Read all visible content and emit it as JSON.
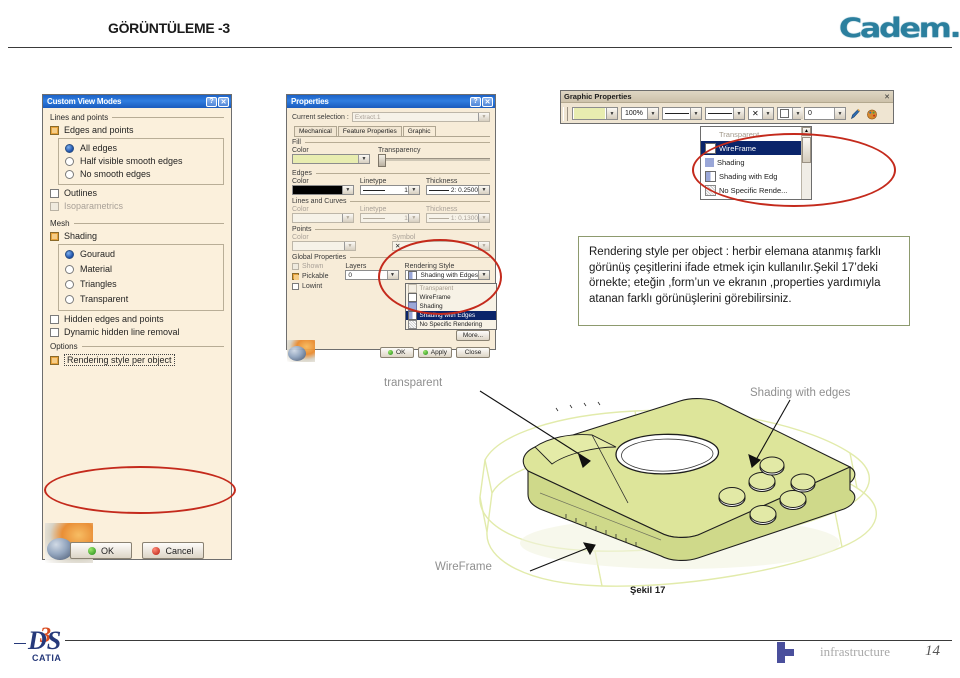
{
  "header": {
    "title": "GÖRÜNTÜLEME -3",
    "brand": "Cadem."
  },
  "footer": {
    "ds_mark": "DS",
    "ds_swoosh": "3",
    "ds_name": "CATIA",
    "infrastructure": "infrastructure",
    "page_number": "14"
  },
  "custom_view_dialog": {
    "title": "Custom View Modes",
    "help_btn": "?",
    "close_btn": "✕",
    "groups": {
      "lines_and_points": "Lines and points",
      "mesh": "Mesh",
      "options": "Options"
    },
    "edges_and_points": "Edges and points",
    "edge_options": [
      "All edges",
      "Half visible smooth edges",
      "No smooth edges"
    ],
    "edge_selected": "All edges",
    "outlines": "Outlines",
    "isoparametrics": "Isoparametrics",
    "shading": "Shading",
    "shading_options": [
      "Gouraud",
      "Material",
      "Triangles",
      "Transparent"
    ],
    "shading_selected": "Gouraud",
    "hidden_edges_and_points": "Hidden edges and points",
    "dynamic_hidden_line_removal": "Dynamic hidden line removal",
    "rendering_style_per_object": "Rendering style per object",
    "ok_label": "OK",
    "cancel_label": "Cancel"
  },
  "properties_dialog": {
    "title": "Properties",
    "help_btn": "?",
    "close_btn": "✕",
    "current_selection_label": "Current selection :",
    "current_selection_value": "Extract.1",
    "tabs": [
      "Mechanical",
      "Feature Properties",
      "Graphic"
    ],
    "active_tab": "Graphic",
    "fill": {
      "group": "Fill",
      "color_label": "Color",
      "color_value": "#e8edb0",
      "transparency_label": "Transparency",
      "transparency_value": "0"
    },
    "edges": {
      "group": "Edges",
      "color_label": "Color",
      "color_value": "#000000",
      "linetype_label": "Linetype",
      "linetype_value": "1",
      "thickness_label": "Thickness",
      "thickness_value": "2: 0.2500"
    },
    "lines_and_curves": {
      "group": "Lines and Curves",
      "color_label": "Color",
      "linetype_label": "Linetype",
      "linetype_value": "1",
      "thickness_label": "Thickness",
      "thickness_value": "1: 0.1300"
    },
    "points": {
      "group": "Points",
      "color_label": "Color",
      "symbol_label": "Symbol",
      "symbol_value": "✕"
    },
    "global_properties": {
      "group": "Global Properties",
      "shown": "Shown",
      "pickable": "Pickable",
      "lowint": "Lowint",
      "layers_label": "Layers",
      "layers_value": "0",
      "rendering_style_label": "Rendering Style",
      "rendering_style_value": "Shading with Edges",
      "rendering_style_options": [
        "Transparent",
        "WireFrame",
        "Shading",
        "Shading with Edges",
        "No Specific Rendering"
      ],
      "rendering_style_selected": "Shading with Edges"
    },
    "more_label": "More...",
    "ok_label": "OK",
    "apply_label": "Apply",
    "close_label": "Close"
  },
  "graphic_properties_toolbar": {
    "title": "Graphic Properties",
    "close_btn": "✕",
    "color_value": "#e8edb0",
    "transparency_value": "100%",
    "linetype_value": "",
    "linewidth_value": "",
    "symbol_value": "✕",
    "rendering_style_value": "",
    "layer_value": "0",
    "paint_icon": "paintbrush-icon",
    "palette_icon": "palette-icon",
    "dropdown_options": [
      "Transparent",
      "WireFrame",
      "Shading",
      "Shading with Edg",
      "No Specific Rende..."
    ],
    "dropdown_selected": "WireFrame"
  },
  "description": {
    "text": "Rendering style per object : herbir elemana atanmış farklı görünüş çeşitlerini ifade etmek için kullanılır.Şekil 17’deki  örnekte; eteğin ,form’un ve ekranın ,properties yardımıyla atanan farklı görünüşlerini görebilirsiniz."
  },
  "model": {
    "callouts": {
      "transparent": "transparent",
      "shading_with_edges": "Shading with edges",
      "wireframe": "WireFrame"
    },
    "caption": "Şekil  17",
    "body_color": "#dde59a",
    "wireframe_color": "#e6eeb0"
  }
}
